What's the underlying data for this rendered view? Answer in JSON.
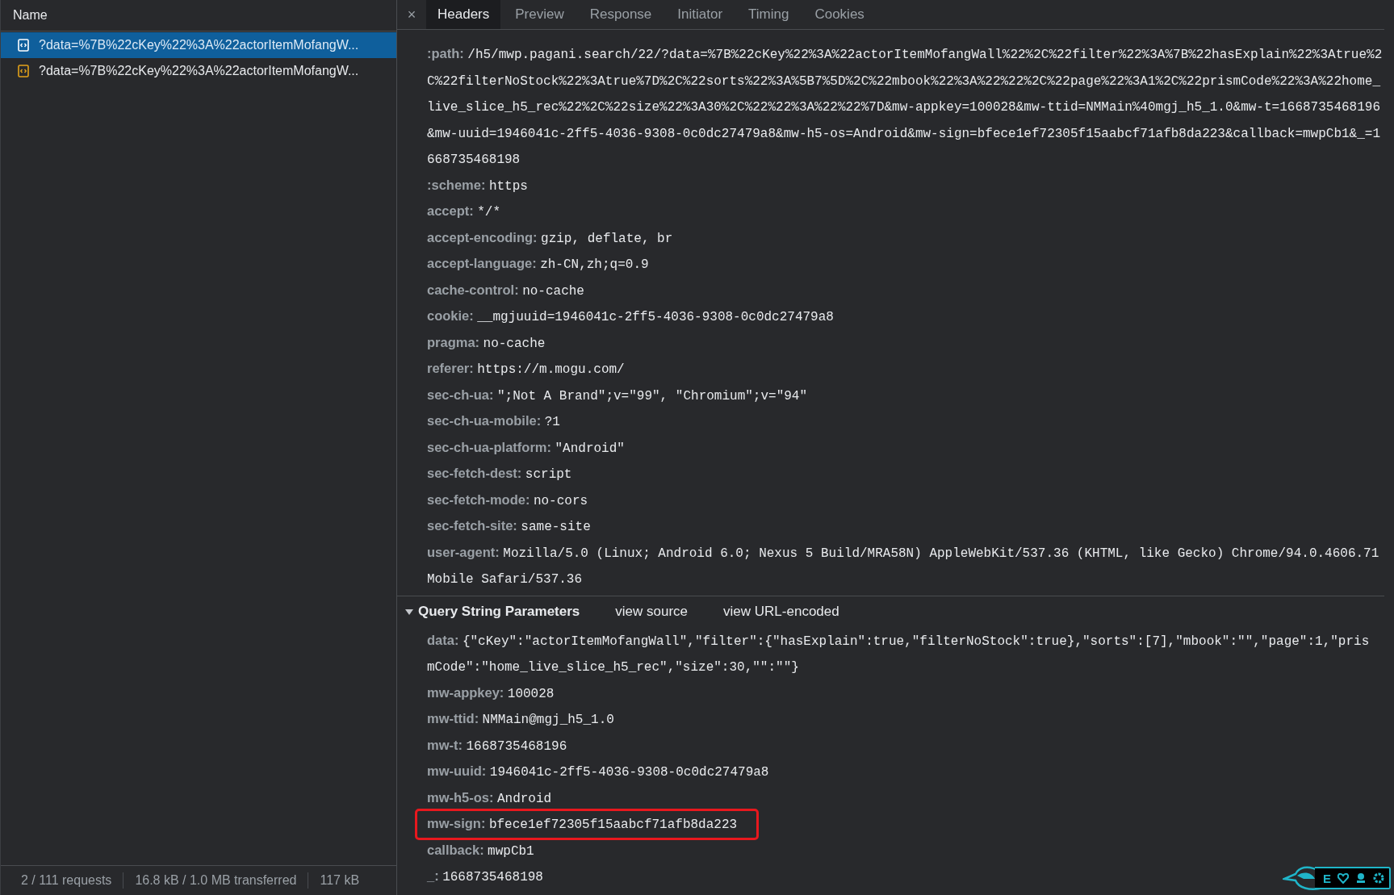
{
  "requests": {
    "column": "Name",
    "items": [
      {
        "label": "?data=%7B%22cKey%22%3A%22actorItemMofangW...",
        "selected": true
      },
      {
        "label": "?data=%7B%22cKey%22%3A%22actorItemMofangW...",
        "selected": false
      }
    ],
    "status_bar": [
      "2 / 111 requests",
      "16.8 kB / 1.0 MB transferred",
      "117 kB"
    ]
  },
  "tabs": [
    {
      "label": "Headers",
      "selected": true
    },
    {
      "label": "Preview",
      "selected": false
    },
    {
      "label": "Response",
      "selected": false
    },
    {
      "label": "Initiator",
      "selected": false
    },
    {
      "label": "Timing",
      "selected": false
    },
    {
      "label": "Cookies",
      "selected": false
    }
  ],
  "close_tab": "×",
  "request_headers": [
    {
      "name": ":path:",
      "value": "/h5/mwp.pagani.search/22/?data=%7B%22cKey%22%3A%22actorItemMofangWall%22%2C%22filter%22%3A%7B%22hasExplain%22%3Atrue%2C%22filterNoStock%22%3Atrue%7D%2C%22sorts%22%3A%5B7%5D%2C%22mbook%22%3A%22%22%2C%22page%22%3A1%2C%22prismCode%22%3A%22home_live_slice_h5_rec%22%2C%22size%22%3A30%2C%22%22%3A%22%22%7D&mw-appkey=100028&mw-ttid=NMMain%40mgj_h5_1.0&mw-t=1668735468196&mw-uuid=1946041c-2ff5-4036-9308-0c0dc27479a8&mw-h5-os=Android&mw-sign=bfece1ef72305f15aabcf71afb8da223&callback=mwpCb1&_=1668735468198"
    },
    {
      "name": ":scheme:",
      "value": "https"
    },
    {
      "name": "accept:",
      "value": "*/*"
    },
    {
      "name": "accept-encoding:",
      "value": "gzip, deflate, br"
    },
    {
      "name": "accept-language:",
      "value": "zh-CN,zh;q=0.9"
    },
    {
      "name": "cache-control:",
      "value": "no-cache"
    },
    {
      "name": "cookie:",
      "value": "__mgjuuid=1946041c-2ff5-4036-9308-0c0dc27479a8"
    },
    {
      "name": "pragma:",
      "value": "no-cache"
    },
    {
      "name": "referer:",
      "value": "https://m.mogu.com/"
    },
    {
      "name": "sec-ch-ua:",
      "value": "\";Not A Brand\";v=\"99\", \"Chromium\";v=\"94\""
    },
    {
      "name": "sec-ch-ua-mobile:",
      "value": "?1"
    },
    {
      "name": "sec-ch-ua-platform:",
      "value": "\"Android\""
    },
    {
      "name": "sec-fetch-dest:",
      "value": "script"
    },
    {
      "name": "sec-fetch-mode:",
      "value": "no-cors"
    },
    {
      "name": "sec-fetch-site:",
      "value": "same-site"
    },
    {
      "name": "user-agent:",
      "value": "Mozilla/5.0 (Linux; Android 6.0; Nexus 5 Build/MRA58N) AppleWebKit/537.36 (KHTML, like Gecko) Chrome/94.0.4606.71 Mobile Safari/537.36"
    }
  ],
  "query_section": {
    "title": "Query String Parameters",
    "expanded": true,
    "links": [
      "view source",
      "view URL-encoded"
    ],
    "params": [
      {
        "name": "data:",
        "value": "{\"cKey\":\"actorItemMofangWall\",\"filter\":{\"hasExplain\":true,\"filterNoStock\":true},\"sorts\":[7],\"mbook\":\"\",\"page\":1,\"prismCode\":\"home_live_slice_h5_rec\",\"size\":30,\"\":\"\"}",
        "highlighted": false
      },
      {
        "name": "mw-appkey:",
        "value": "100028",
        "highlighted": false
      },
      {
        "name": "mw-ttid:",
        "value": "NMMain@mgj_h5_1.0",
        "highlighted": false
      },
      {
        "name": "mw-t:",
        "value": "1668735468196",
        "highlighted": false
      },
      {
        "name": "mw-uuid:",
        "value": "1946041c-2ff5-4036-9308-0c0dc27479a8",
        "highlighted": false
      },
      {
        "name": "mw-h5-os:",
        "value": "Android",
        "highlighted": false
      },
      {
        "name": "mw-sign:",
        "value": "bfece1ef72305f15aabcf71afb8da223",
        "highlighted": true
      },
      {
        "name": "callback:",
        "value": "mwpCb1",
        "highlighted": false
      },
      {
        "name": "_:",
        "value": "1668735468198",
        "highlighted": false
      }
    ]
  },
  "overlay_widget": {
    "label": "E"
  }
}
